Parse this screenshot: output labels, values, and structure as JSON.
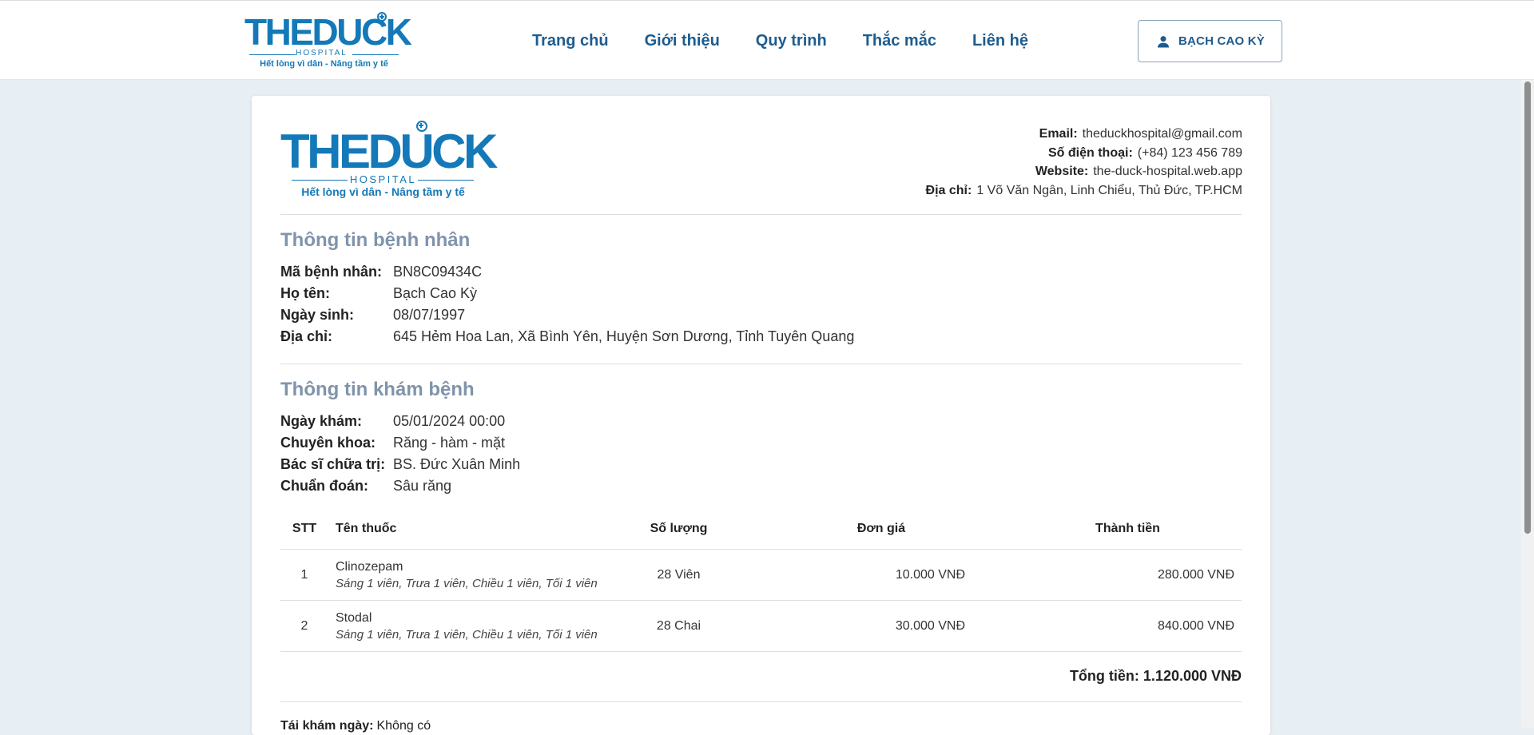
{
  "header": {
    "logo": {
      "wordmark": "THEDUCK",
      "sub": "HOSPITAL",
      "tagline": "Hết lòng vì dân - Nâng tầm y tế"
    },
    "nav": [
      "Trang chủ",
      "Giới thiệu",
      "Quy trình",
      "Thắc mắc",
      "Liên hệ"
    ],
    "user_button": "BẠCH CAO KỲ",
    "user_icon": "person-icon"
  },
  "document": {
    "logo": {
      "wordmark": "THEDUCK",
      "sub": "HOSPITAL",
      "tagline": "Hết lòng vì dân - Nâng tầm y tế"
    },
    "contact": [
      {
        "label": "Email:",
        "value": "theduckhospital@gmail.com"
      },
      {
        "label": "Số điện thoại:",
        "value": "(+84) 123 456 789"
      },
      {
        "label": "Website:",
        "value": "the-duck-hospital.web.app"
      },
      {
        "label": "Địa chỉ:",
        "value": "1 Võ Văn Ngân, Linh Chiểu, Thủ Đức, TP.HCM"
      }
    ],
    "patient": {
      "title": "Thông tin bệnh nhân",
      "fields": [
        {
          "label": "Mã bệnh nhân:",
          "value": "BN8C09434C"
        },
        {
          "label": "Họ tên:",
          "value": "Bạch Cao Kỳ"
        },
        {
          "label": "Ngày sinh:",
          "value": "08/07/1997"
        },
        {
          "label": "Địa chỉ:",
          "value": "645 Hẻm Hoa Lan, Xã Bình Yên, Huyện Sơn Dương, Tỉnh Tuyên Quang"
        }
      ]
    },
    "exam": {
      "title": "Thông tin khám bệnh",
      "fields": [
        {
          "label": "Ngày khám:",
          "value": "05/01/2024 00:00"
        },
        {
          "label": "Chuyên khoa:",
          "value": "Răng - hàm - mặt"
        },
        {
          "label": "Bác sĩ chữa trị:",
          "value": "BS. Đức Xuân Minh"
        },
        {
          "label": "Chuẩn đoán:",
          "value": "Sâu răng"
        }
      ]
    },
    "table": {
      "headers": [
        "STT",
        "Tên thuốc",
        "Số lượng",
        "Đơn giá",
        "Thành tiền"
      ],
      "rows": [
        {
          "stt": "1",
          "name": "Clinozepam",
          "note": "Sáng 1 viên, Trưa 1 viên, Chiều 1 viên, Tối 1 viên",
          "qty": "28 Viên",
          "price": "10.000 VNĐ",
          "total": "280.000 VNĐ"
        },
        {
          "stt": "2",
          "name": "Stodal",
          "note": "Sáng 1 viên, Trưa 1 viên, Chiều 1 viên, Tối 1 viên",
          "qty": "28 Chai",
          "price": "30.000 VNĐ",
          "total": "840.000 VNĐ"
        }
      ]
    },
    "grand_total": "Tổng tiền: 1.120.000 VNĐ",
    "followup": {
      "label": "Tái khám ngày:",
      "value": "Không có"
    }
  },
  "colors": {
    "brand": "#1479b8",
    "nav": "#1d5c8f",
    "section_title": "#7f94ab",
    "page_bg": "#e8eff4"
  }
}
